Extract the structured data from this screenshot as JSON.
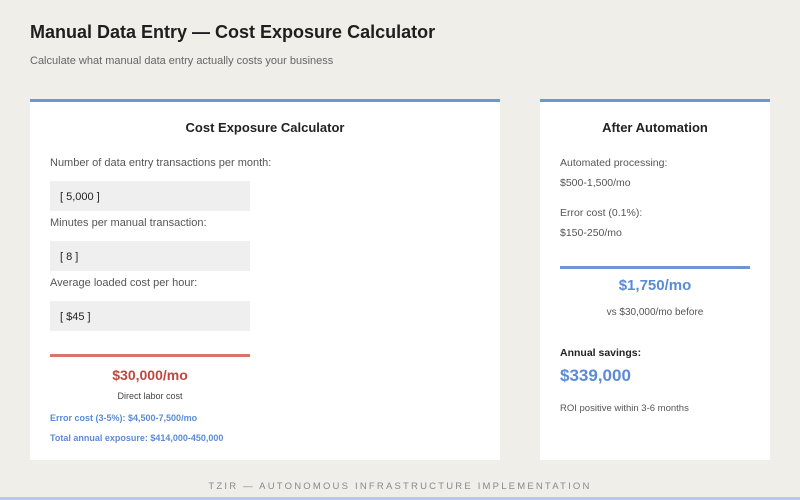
{
  "header": {
    "title": "Manual Data Entry — Cost Exposure Calculator",
    "subtitle": "Calculate what manual data entry actually costs your business"
  },
  "calculator": {
    "title": "Cost Exposure Calculator",
    "fields": [
      {
        "label": "Number of data entry transactions per month:",
        "value": "[ 5,000 ]"
      },
      {
        "label": "Minutes per manual transaction:",
        "value": "[ 8 ]"
      },
      {
        "label": "Average loaded cost per hour:",
        "value": "[ $45 ]"
      }
    ],
    "result": {
      "amount": "$30,000/mo",
      "caption": "Direct labor cost",
      "error_cost": "Error cost (3-5%): $4,500-7,500/mo",
      "total_exposure": "Total annual exposure: $414,000-450,000"
    },
    "colors": {
      "accent": "#6f95d6",
      "danger": "#c0473f",
      "danger_line": "#d9736c"
    }
  },
  "automation": {
    "title": "After Automation",
    "processing_label": "Automated processing:",
    "processing_value": "$500-1,500/mo",
    "error_label": "Error cost (0.1%):",
    "error_value": "$150-250/mo",
    "total": "$1,750/mo",
    "comparison": "vs $30,000/mo before",
    "savings_label": "Annual savings:",
    "savings_value": "$339,000",
    "roi": "ROI positive within 3-6 months"
  },
  "footer": {
    "text": "TZIR — AUTONOMOUS INFRASTRUCTURE IMPLEMENTATION"
  }
}
